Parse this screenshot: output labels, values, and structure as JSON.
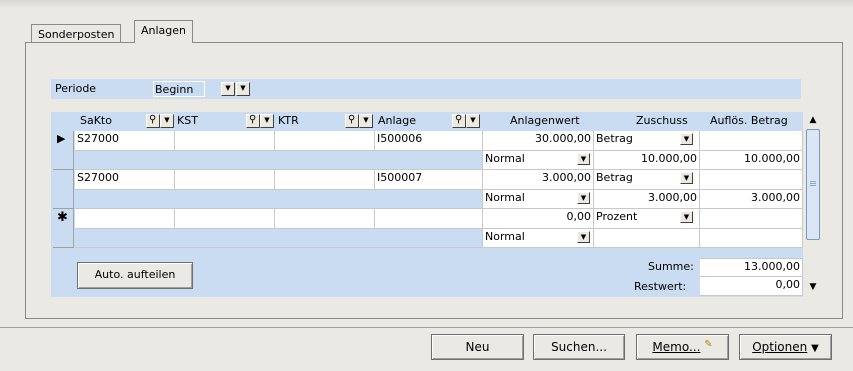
{
  "tabs": [
    {
      "label": "Sonderposten"
    },
    {
      "label": "Anlagen"
    }
  ],
  "periode": {
    "label": "Periode",
    "value": "Beginn"
  },
  "columns": {
    "sakto": "SaKto",
    "kst": "KST",
    "ktr": "KTR",
    "anlage": "Anlage",
    "anlagenwert": "Anlagenwert",
    "zuschuss": "Zuschuss",
    "aufloes": "Auflös. Betrag"
  },
  "rows": [
    {
      "sakto": "S27000",
      "anlage": "I500006",
      "anlagenwert": "30.000,00",
      "zuschuss_art": "Betrag",
      "mode": "Normal",
      "zuschuss": "10.000,00",
      "aufloes": "10.000,00"
    },
    {
      "sakto": "S27000",
      "anlage": "I500007",
      "anlagenwert": "3.000,00",
      "zuschuss_art": "Betrag",
      "mode": "Normal",
      "zuschuss": "3.000,00",
      "aufloes": "3.000,00"
    },
    {
      "sakto": "",
      "anlage": "",
      "anlagenwert": "0,00",
      "zuschuss_art": "Prozent",
      "mode": "Normal",
      "zuschuss": "",
      "aufloes": ""
    }
  ],
  "indicators": {
    "current": "▶",
    "new": "✱"
  },
  "footer": {
    "auto_button": "Auto. aufteilen",
    "summe_label": "Summe:",
    "summe_value": "13.000,00",
    "restwert_label": "Restwert:",
    "restwert_value": "0,00"
  },
  "buttons": {
    "neu": "Neu",
    "suchen": "Suchen...",
    "memo": "Memo...",
    "optionen": "Optionen"
  },
  "glyphs": {
    "dropdown": "▼",
    "search": "⚲",
    "scroll_up": "▲",
    "scroll_down": "▼",
    "memo_icon": "✎"
  }
}
